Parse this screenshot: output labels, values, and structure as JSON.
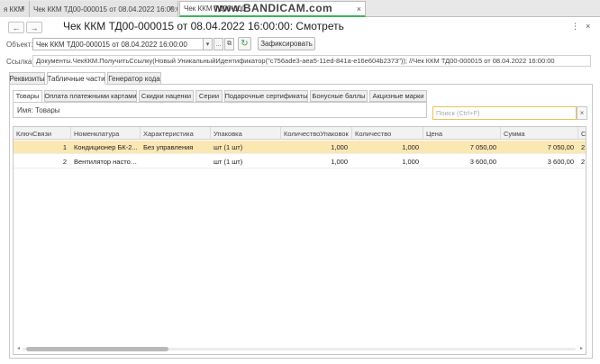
{
  "tabs": [
    {
      "label": "я ККМ"
    },
    {
      "label": "Чек ККМ ТД00-000015 от 08.04.2022 16:00:00"
    },
    {
      "label": "Чек ККМ ТД00-000"
    }
  ],
  "watermark": "www.BANDICAM.com",
  "header": {
    "title": "Чек ККМ ТД00-000015 от 08.04.2022 16:00:00: Смотреть",
    "back": "←",
    "forward": "→",
    "more": "⋮",
    "close": "×"
  },
  "object": {
    "label": "Объект:",
    "value": "Чек ККМ ТД00-000015 от 08.04.2022 16:00:00",
    "dropdown": "▾",
    "ellipsis": "...",
    "fix_button": "Зафиксировать"
  },
  "link": {
    "label": "Ссылка:",
    "value": "Документы.ЧекККМ.ПолучитьСсылку(Новый УникальныйИдентификатор(\"c756ade3-aea5-11ed-841a-e16e604b2373\")); //Чек ККМ ТД00-000015 от 08.04.2022 16:00:00"
  },
  "outer_tabs": [
    "Реквизиты",
    "Табличные части",
    "Генератор кода"
  ],
  "inner_tabs": [
    "Товары",
    "Оплата платежными картами",
    "Скидки наценки",
    "Серии",
    "Подарочные сертификаты",
    "Бонусные баллы",
    "Акцизные марки"
  ],
  "name_field": "Имя: Товары",
  "search": {
    "placeholder": "Поиск (Ctrl+F)",
    "clear": "×"
  },
  "table": {
    "columns": [
      "КлючСвязи",
      "Номенклатура",
      "Характеристика",
      "Упаковка",
      "КоличествоУпаковок",
      "Количество",
      "Цена",
      "Сумма",
      "С"
    ],
    "rows": [
      [
        "1",
        "Кондиционер БК-2...",
        "Без управления",
        "шт (1 шт)",
        "1,000",
        "1,000",
        "7 050,00",
        "7 050,00",
        "2"
      ],
      [
        "2",
        "Вентилятор настол...",
        "",
        "шт (1 шт)",
        "1,000",
        "1,000",
        "3 600,00",
        "3 600,00",
        "2"
      ]
    ]
  },
  "colors": {
    "accent": "#3cb55a",
    "selected_row": "#fbe7b2",
    "search_border": "#e8c25a"
  }
}
